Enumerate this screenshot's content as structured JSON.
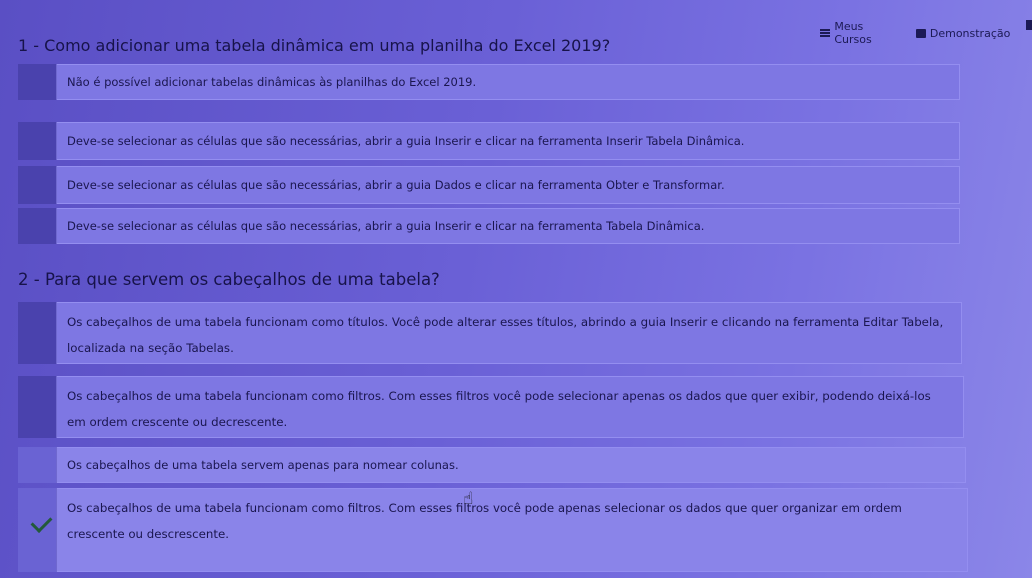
{
  "nav": {
    "meus_cursos": "Meus Cursos",
    "demonstracao": "Demonstração"
  },
  "questions": [
    {
      "title": "1 - Como adicionar uma tabela dinâmica em uma planilha do Excel 2019?",
      "options": [
        "Não é possível adicionar tabelas dinâmicas às planilhas do Excel 2019.",
        "Deve-se selecionar as células que são necessárias, abrir a guia Inserir e clicar na ferramenta Inserir Tabela Dinâmica.",
        "Deve-se selecionar as células que são necessárias, abrir a guia Dados e clicar na ferramenta Obter e Transformar.",
        "Deve-se selecionar as células que são necessárias, abrir a guia Inserir e clicar na ferramenta Tabela Dinâmica."
      ]
    },
    {
      "title": "2 - Para que servem os cabeçalhos de uma tabela?",
      "options": [
        "Os cabeçalhos de uma tabela funcionam como títulos. Você pode alterar esses títulos, abrindo a guia Inserir e clicando na ferramenta Editar Tabela, localizada na seção Tabelas.",
        "Os cabeçalhos de uma tabela funcionam como filtros. Com esses filtros você pode selecionar apenas os dados que quer exibir, podendo deixá-los em ordem crescente ou decrescente.",
        "Os cabeçalhos de uma tabela servem apenas para nomear colunas.",
        "Os cabeçalhos de uma tabela funcionam como filtros. Com esses filtros você pode apenas selecionar os dados que quer organizar em ordem crescente ou descrescente."
      ]
    }
  ],
  "icons": {
    "selected": "check-icon",
    "cursor": "hand-cursor-icon"
  },
  "colors": {
    "marker": "#4a42ad",
    "check": "#235a3a"
  }
}
